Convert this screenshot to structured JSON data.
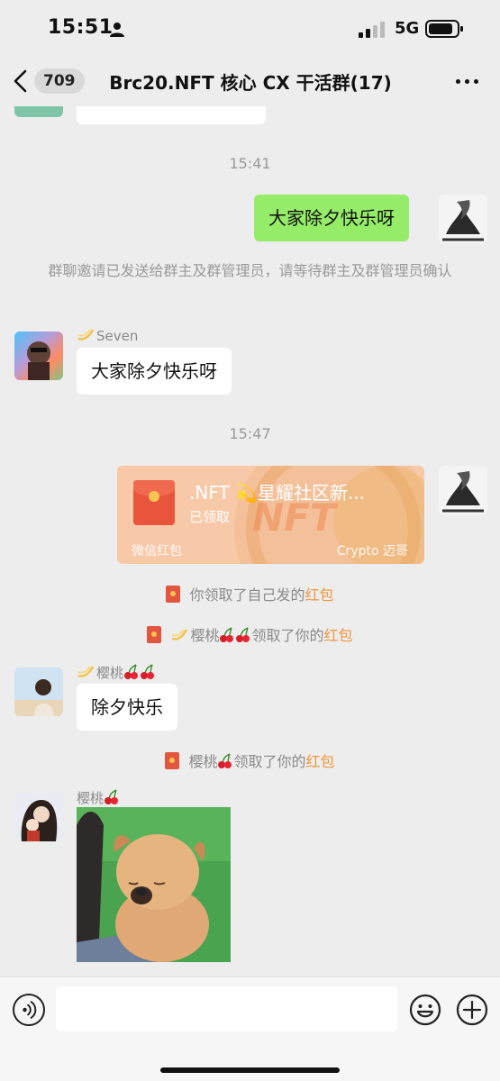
{
  "status_bar": {
    "time": "15:51",
    "network": "5G"
  },
  "nav": {
    "unread_count": "709",
    "title": "Brc20.NFT  核心 CX 干活群(17)"
  },
  "messages": {
    "time_1": "15:41",
    "self_text_1": "大家除夕快乐呀",
    "system_invite": "群聊邀请已发送给群主及群管理员，请等待群主及群管理员确认",
    "seven_name": "Seven",
    "seven_text": "大家除夕快乐呀",
    "time_2": "15:47",
    "red_packet": {
      "title": ".NFT 💫星耀社区新...",
      "status": "已领取",
      "footer_label": "微信红包",
      "brand": "Crypto 迈哥",
      "watermark": "NFT"
    },
    "notice_self_claim": {
      "prefix": "你领取了自己发的",
      "link": "红包"
    },
    "notice_yingtao_claim_1": {
      "name": "樱桃",
      "middle": "领取了你的",
      "link": "红包"
    },
    "yingtao_name_1": "樱桃",
    "yingtao_text": "除夕快乐",
    "notice_yingtao_claim_2": {
      "name": "樱桃",
      "middle": "领取了你的",
      "link": "红包"
    },
    "yingtao_name_2": "樱桃"
  },
  "input": {
    "placeholder": "",
    "value": ""
  },
  "colors": {
    "self_bubble": "#95ec69",
    "highlight_link": "#f0973a",
    "chat_bg": "#ededed"
  },
  "icons": [
    "back-chevron-icon",
    "more-icon",
    "voice-icon",
    "emoji-icon",
    "plus-icon",
    "red-packet-icon",
    "cherry-icon",
    "sparkle-icon"
  ]
}
